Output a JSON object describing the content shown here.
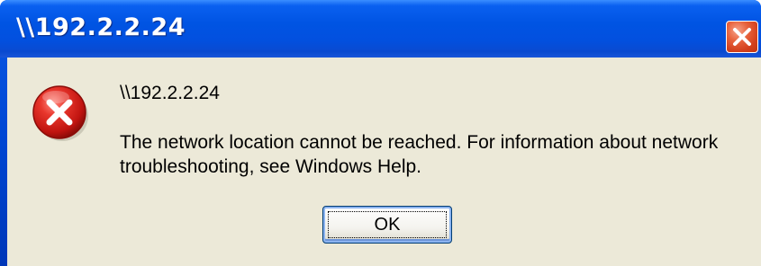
{
  "window": {
    "title": "\\\\192.2.2.24",
    "close_icon": "close-icon"
  },
  "dialog": {
    "icon": "error-icon",
    "path_text": "\\\\192.2.2.24",
    "message": "The network location cannot be reached. For information about network troubleshooting, see Windows Help.",
    "ok_label": "OK"
  },
  "colors": {
    "titlebar": "#0054e3",
    "client_bg": "#ece9d8",
    "close_button": "#e0522c",
    "error_red": "#d8201c"
  }
}
